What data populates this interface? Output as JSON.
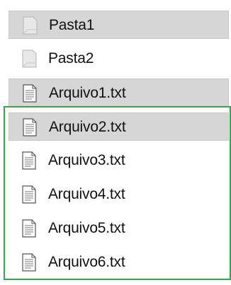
{
  "colors": {
    "selected_row": "#d6d6d6",
    "selection_border": "#2fa84a"
  },
  "items": [
    {
      "label": "Pasta1",
      "icon": "folder-icon"
    },
    {
      "label": "Pasta2",
      "icon": "folder-icon"
    },
    {
      "label": "Arquivo1.txt",
      "icon": "text-file-icon"
    },
    {
      "label": "Arquivo2.txt",
      "icon": "text-file-icon"
    },
    {
      "label": "Arquivo3.txt",
      "icon": "text-file-icon"
    },
    {
      "label": "Arquivo4.txt",
      "icon": "text-file-icon"
    },
    {
      "label": "Arquivo5.txt",
      "icon": "text-file-icon"
    },
    {
      "label": "Arquivo6.txt",
      "icon": "text-file-icon"
    }
  ]
}
